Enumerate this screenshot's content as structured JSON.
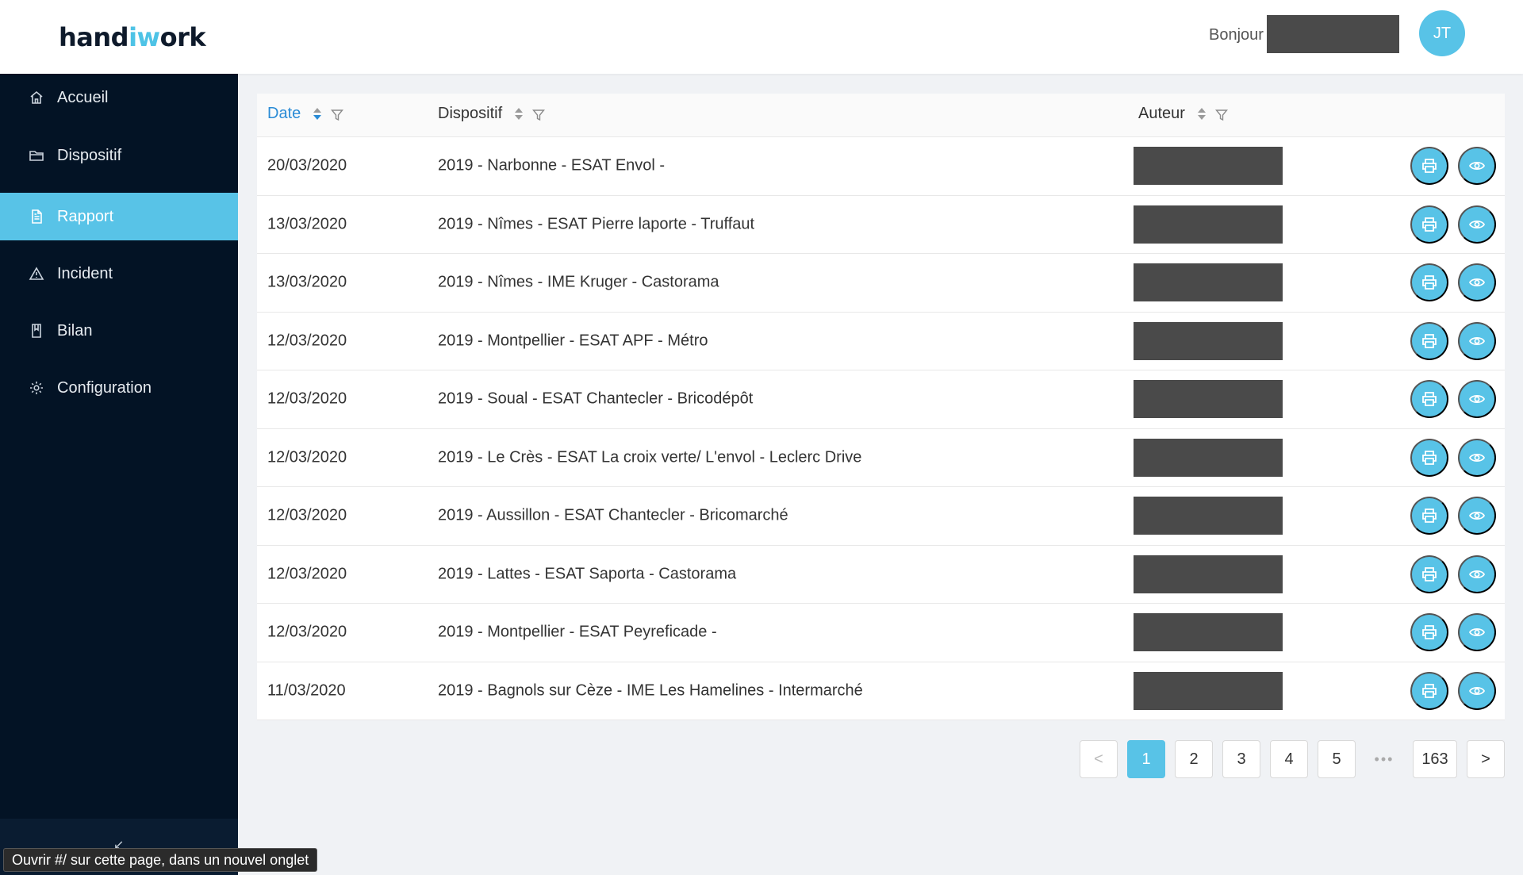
{
  "header": {
    "logo": {
      "part1": "hand",
      "part2": "iw",
      "part3": "ork"
    },
    "greeting": "Bonjour",
    "avatar_initials": "JT"
  },
  "sidebar": {
    "items": [
      {
        "label": "Accueil",
        "icon": "home-icon"
      },
      {
        "label": "Dispositif",
        "icon": "folder-icon"
      },
      {
        "label": "Rapport",
        "icon": "document-icon",
        "active": true
      },
      {
        "label": "Incident",
        "icon": "warning-icon"
      },
      {
        "label": "Bilan",
        "icon": "book-icon"
      },
      {
        "label": "Configuration",
        "icon": "gear-icon"
      }
    ],
    "collapse_icon": "collapse-icon"
  },
  "tooltip": "Ouvrir #/ sur cette page, dans un nouvel onglet",
  "table": {
    "columns": {
      "date": "Date",
      "dispositif": "Dispositif",
      "auteur": "Auteur"
    },
    "rows": [
      {
        "date": "20/03/2020",
        "dispositif": "2019 - Narbonne - ESAT Envol -"
      },
      {
        "date": "13/03/2020",
        "dispositif": "2019 - Nîmes - ESAT Pierre laporte - Truffaut"
      },
      {
        "date": "13/03/2020",
        "dispositif": "2019 - Nîmes - IME Kruger - Castorama"
      },
      {
        "date": "12/03/2020",
        "dispositif": "2019 - Montpellier - ESAT APF - Métro"
      },
      {
        "date": "12/03/2020",
        "dispositif": "2019 - Soual - ESAT Chantecler - Bricodépôt"
      },
      {
        "date": "12/03/2020",
        "dispositif": "2019 - Le Crès - ESAT La croix verte/ L'envol - Leclerc Drive"
      },
      {
        "date": "12/03/2020",
        "dispositif": "2019 - Aussillon - ESAT Chantecler - Bricomarché"
      },
      {
        "date": "12/03/2020",
        "dispositif": "2019 - Lattes - ESAT Saporta - Castorama"
      },
      {
        "date": "12/03/2020",
        "dispositif": "2019 - Montpellier - ESAT Peyreficade -"
      },
      {
        "date": "11/03/2020",
        "dispositif": "2019 - Bagnols sur Cèze - IME Les Hamelines - Intermarché"
      }
    ]
  },
  "pagination": {
    "prev": "<",
    "pages": [
      "1",
      "2",
      "3",
      "4",
      "5"
    ],
    "current": "1",
    "ellipsis": "•••",
    "last": "163",
    "next": ">"
  },
  "colors": {
    "accent": "#58c3e7",
    "sidebar_bg": "#031325",
    "sort_active": "#2a8bd6"
  }
}
